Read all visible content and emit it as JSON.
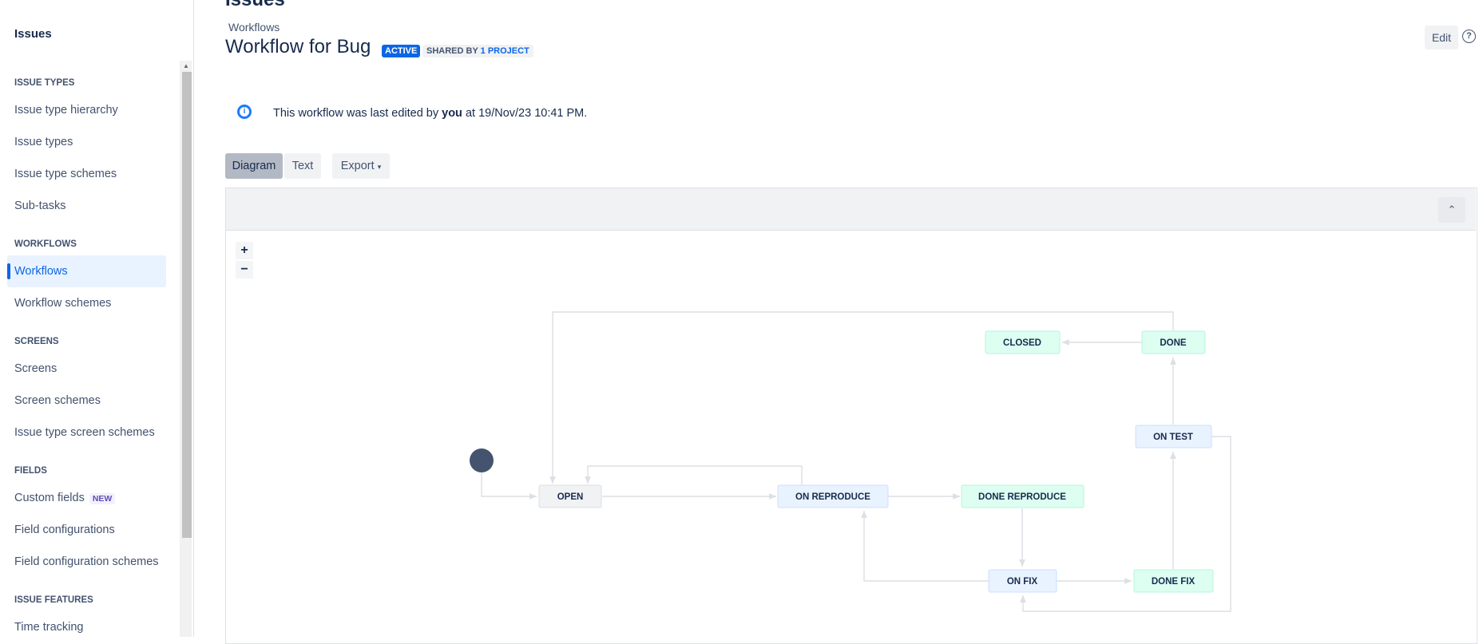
{
  "sidebar": {
    "title": "Issues",
    "sections": {
      "issue_types": "ISSUE TYPES",
      "workflows": "WORKFLOWS",
      "screens": "SCREENS",
      "fields": "FIELDS",
      "issue_features": "ISSUE FEATURES"
    },
    "items": {
      "issue_type_hierarchy": "Issue type hierarchy",
      "issue_types": "Issue types",
      "issue_type_schemes": "Issue type schemes",
      "sub_tasks": "Sub-tasks",
      "workflows": "Workflows",
      "workflow_schemes": "Workflow schemes",
      "screens": "Screens",
      "screen_schemes": "Screen schemes",
      "issue_type_screen_schemes": "Issue type screen schemes",
      "custom_fields": "Custom fields",
      "custom_fields_badge": "NEW",
      "field_configurations": "Field configurations",
      "field_configuration_schemes": "Field configuration schemes",
      "time_tracking": "Time tracking"
    },
    "active_item": "Workflows"
  },
  "header": {
    "top_title": "Issues",
    "breadcrumb": "Workflows",
    "title": "Workflow for Bug",
    "status_lozenge": "ACTIVE",
    "shared_prefix": "SHARED BY",
    "shared_link": "1 PROJECT",
    "edit_label": "Edit",
    "help_icon": "?"
  },
  "info": {
    "icon": "info-icon",
    "text_before": "This workflow was last edited by ",
    "user": "you",
    "text_after": " at 19/Nov/23 10:41 PM."
  },
  "tabs": {
    "diagram": "Diagram",
    "text": "Text",
    "export": "Export",
    "selected": "Diagram"
  },
  "zoom": {
    "in": "+",
    "out": "−"
  },
  "workflow": {
    "nodes": {
      "open": "OPEN",
      "on_reproduce": "ON REPRODUCE",
      "done_reproduce": "DONE REPRODUCE",
      "on_fix": "ON FIX",
      "done_fix": "DONE FIX",
      "on_test": "ON TEST",
      "done": "DONE",
      "closed": "CLOSED"
    },
    "colors": {
      "todo_fill": "#f1f2f4",
      "todo_stroke": "#dcdfe4",
      "progress_fill": "#e9f2ff",
      "progress_stroke": "#cce0ff",
      "done_fill": "#dcfff1",
      "done_stroke": "#baf3db",
      "start": "#44546f",
      "connector": "#dcdfe4"
    }
  }
}
